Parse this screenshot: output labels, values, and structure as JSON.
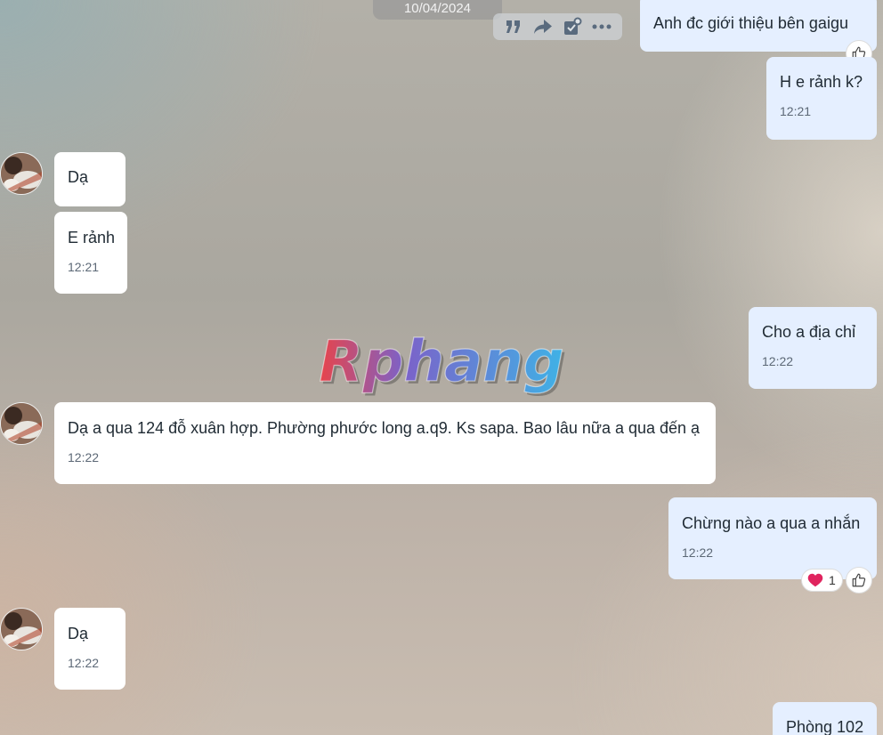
{
  "date_separator": "10/04/2024",
  "toolbar": {
    "icons": [
      "quote-icon",
      "forward-icon",
      "mark-todo-icon",
      "more-icon"
    ]
  },
  "watermark_text": "Rphang",
  "messages": [
    {
      "side": "out",
      "text": "Anh đc giới thiệu bên gaigu",
      "time": ""
    },
    {
      "side": "out",
      "text": "H e rảnh k?",
      "time": "12:21"
    },
    {
      "side": "in",
      "text": "Dạ",
      "time": ""
    },
    {
      "side": "in",
      "text": "E rảnh",
      "time": "12:21"
    },
    {
      "side": "out",
      "text": "Cho a địa chỉ",
      "time": "12:22"
    },
    {
      "side": "in",
      "text": "Dạ a qua 124 đỗ xuân hợp. Phường phước long a.q9. Ks sapa.  Bao lâu nữa a qua đến ạ",
      "time": "12:22"
    },
    {
      "side": "out",
      "text": "Chừng nào a qua a nhắn",
      "time": "12:22",
      "reaction": {
        "emoji": "❤️",
        "count": "1"
      }
    },
    {
      "side": "in",
      "text": "Dạ",
      "time": "12:22"
    },
    {
      "side": "out",
      "text": "Phòng 102",
      "time": ""
    }
  ],
  "colors": {
    "incoming_bubble": "#ffffff",
    "outgoing_bubble": "#e5efff",
    "heart": "#e0245e"
  }
}
